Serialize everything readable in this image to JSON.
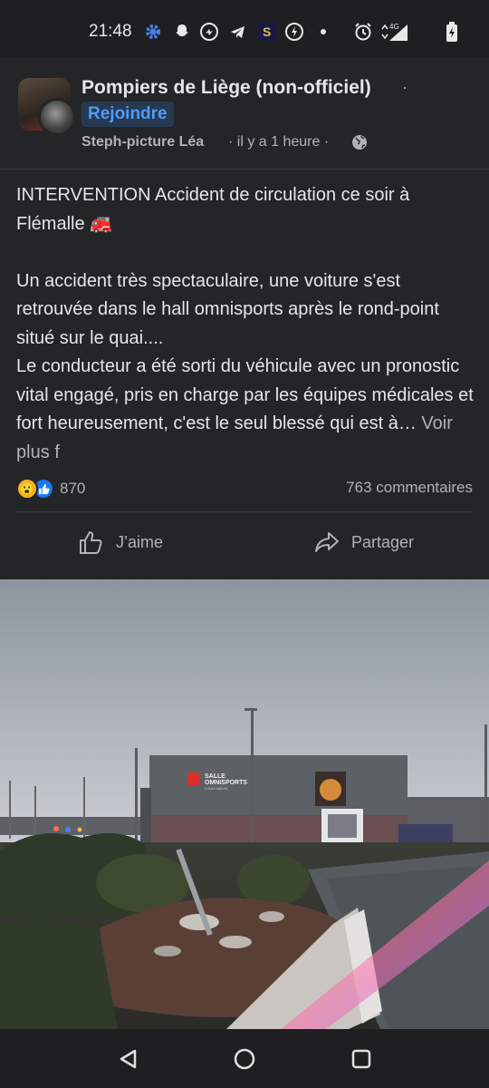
{
  "status_bar": {
    "time": "21:48",
    "left_icons": [
      "gear-icon",
      "snapchat-icon",
      "messenger-icon",
      "telegram-icon",
      "app-s-icon",
      "power-icon",
      "dot-icon"
    ],
    "right_icons": [
      "alarm-icon",
      "signal-4g-icon",
      "battery-charging-icon"
    ],
    "network_label": "4G"
  },
  "post": {
    "group_name": "Pompiers de Liège (non-officiel)",
    "separator": "·",
    "join_label": "Rejoindre",
    "author": "Steph-picture Léa",
    "time": "· il y a 1 heure ·",
    "text_p1": "INTERVENTION Accident de circulation ce soir à Flémalle 🚒",
    "text_p2": "Un accident très spectaculaire, une voiture s'est retrouvée dans le hall omnisports après le rond-point situé sur le quai....",
    "text_p3": "Le conducteur a été sorti du véhicule avec un pronostic vital engagé, pris en charge par les équipes médicales et fort heureusement, c'est le seul blessé qui est à…",
    "see_more": " Voir plus f",
    "reactions": {
      "types": [
        "wow",
        "like"
      ],
      "wow_emoji": "😮",
      "count": "870"
    },
    "comments": "763 commentaires",
    "actions": {
      "like_label": "J’aime",
      "share_label": "Partager"
    }
  },
  "photo": {
    "sign_line1": "SALLE",
    "sign_line2": "OMNISPORTS",
    "sign_line3": "LOUIS MELIN"
  },
  "nav": {
    "icons": [
      "back-triangle-icon",
      "home-circle-icon",
      "recents-square-icon"
    ]
  },
  "colors": {
    "card_bg": "#242526",
    "accent_blue": "#4f9cf9",
    "text_primary": "#e4e6eb",
    "text_secondary": "#b0b3b8"
  }
}
